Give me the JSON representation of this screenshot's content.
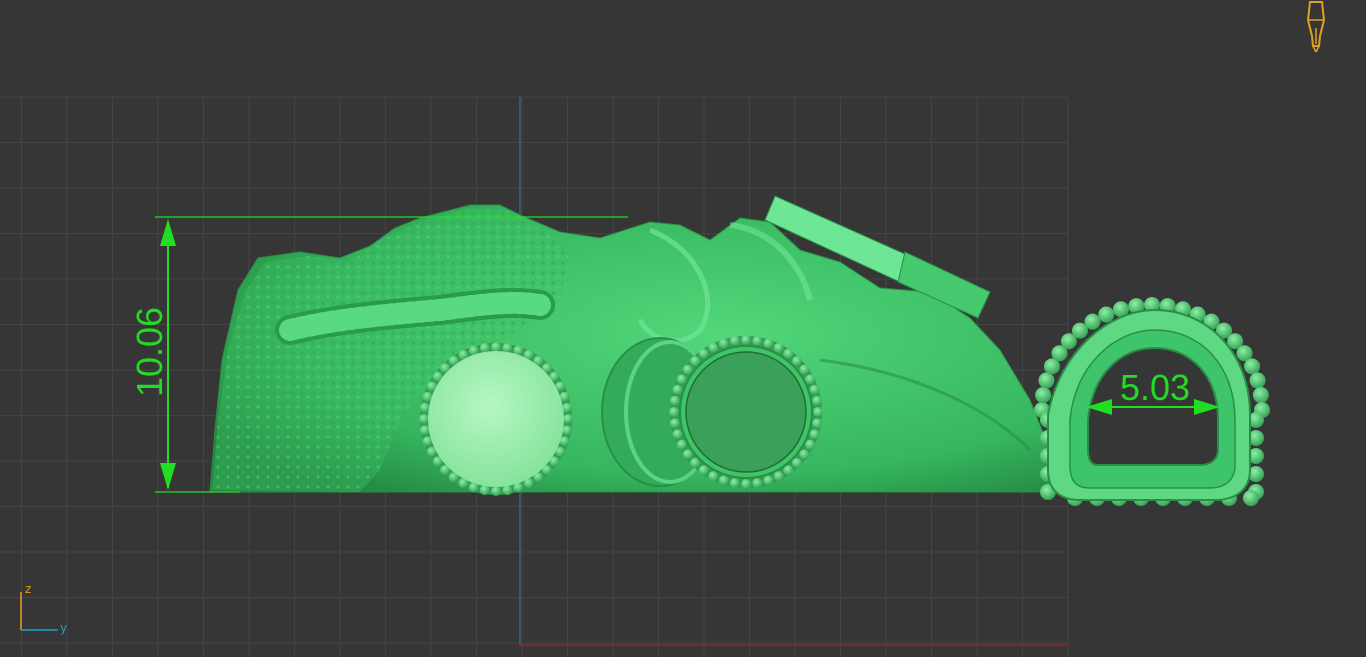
{
  "viewport": {
    "background": "#363636",
    "grid_color": "#444444",
    "model_color": "#3ec46a",
    "dimension_color": "#22dd22"
  },
  "dimensions": {
    "height_value": "10.06",
    "opening_width_value": "5.03"
  },
  "axes": {
    "vertical_label": "z",
    "horizontal_label": "y",
    "vertical_color": "#e0a020",
    "horizontal_color": "#20a0d0"
  },
  "view_gizmo": {
    "icon": "pen-nib-icon",
    "color": "#e0a020"
  }
}
